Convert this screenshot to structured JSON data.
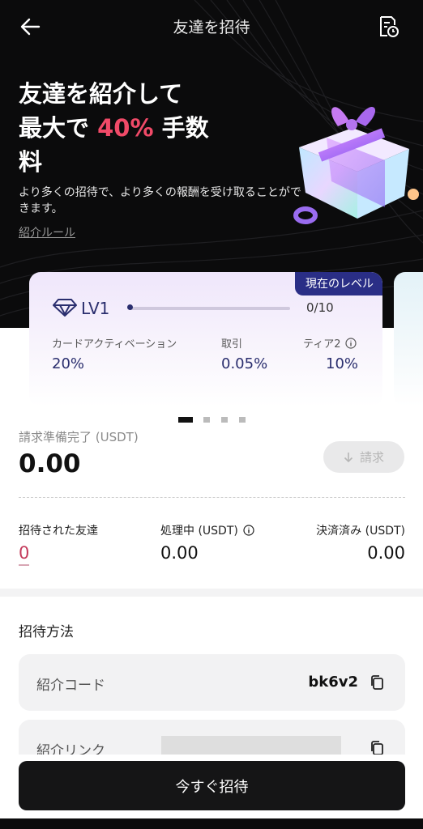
{
  "header": {
    "title": "友達を招待",
    "back_icon": "arrow-left-icon",
    "history_icon": "document-clock-icon"
  },
  "hero": {
    "headline_line1": "友達を紹介して",
    "headline_pre": "最大で ",
    "headline_accent": "40%",
    "headline_post": " 手数",
    "headline_line3": "料",
    "subtitle": "より多くの招待で、より多くの報酬を受け取ることができます。",
    "rules_link": "紹介ルール",
    "accent_color": "#f04a68"
  },
  "level_card": {
    "badge": "現在のレベル",
    "level": "LV1",
    "progress_text": "0/10",
    "progress_fraction": 0.0,
    "columns": [
      {
        "label": "カードアクティベーション",
        "value": "20%"
      },
      {
        "label": "取引",
        "value": "0.05%"
      },
      {
        "label": "ティア2",
        "value": "10%"
      }
    ]
  },
  "carousel": {
    "pages": 4,
    "active_index": 0
  },
  "claim": {
    "label": "請求準備完了 (USDT)",
    "amount": "0.00",
    "button_label": "請求"
  },
  "stats": {
    "friends_label": "招待された友達",
    "friends_value": "0",
    "processing_label": "処理中 (USDT)",
    "processing_value": "0.00",
    "settled_label": "決済済み (USDT)",
    "settled_value": "0.00"
  },
  "invite_method": {
    "title": "招待方法",
    "code_label": "紹介コード",
    "code_value": "bk6v2",
    "link_label": "紹介リンク"
  },
  "cta": {
    "label": "今すぐ招待"
  }
}
